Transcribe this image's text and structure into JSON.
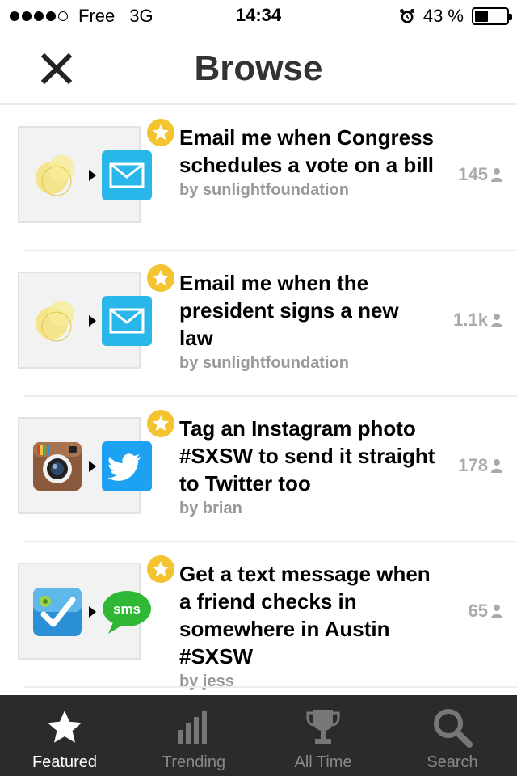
{
  "status_bar": {
    "carrier": "Free",
    "network": "3G",
    "time": "14:34",
    "battery": "43 %",
    "battery_level": 0.43,
    "signal_bars": 4,
    "signal_max": 5
  },
  "header": {
    "title": "Browse",
    "close_icon": "close-icon"
  },
  "colors": {
    "star_badge": "#f4c430",
    "tab_bar": "#2b2b2b",
    "email_blue": "#29b6e8",
    "twitter_blue": "#1da1f2",
    "sms_green": "#2fb835"
  },
  "recipes": [
    {
      "title": "Email me when Congress schedules a vote on a bill",
      "author": "by sunlightfoundation",
      "count": "145",
      "trigger_icon": "sunlight-foundation-icon",
      "action_icon": "email-icon"
    },
    {
      "title": "Email me when the president signs a new law",
      "author": "by sunlightfoundation",
      "count": "1.1k",
      "trigger_icon": "sunlight-foundation-icon",
      "action_icon": "email-icon"
    },
    {
      "title": "Tag an Instagram photo #SXSW to send it straight to Twitter too",
      "author": "by brian",
      "count": "178",
      "trigger_icon": "instagram-icon",
      "action_icon": "twitter-icon"
    },
    {
      "title": "Get a text message when a friend checks in somewhere in Austin #SXSW",
      "author": "by jess",
      "count": "65",
      "trigger_icon": "foursquare-icon",
      "action_icon": "sms-icon",
      "sms_label": "sms"
    }
  ],
  "tabs": [
    {
      "label": "Featured",
      "icon": "star-icon",
      "active": true
    },
    {
      "label": "Trending",
      "icon": "bar-chart-icon",
      "active": false
    },
    {
      "label": "All Time",
      "icon": "trophy-icon",
      "active": false
    },
    {
      "label": "Search",
      "icon": "search-icon",
      "active": false
    }
  ]
}
